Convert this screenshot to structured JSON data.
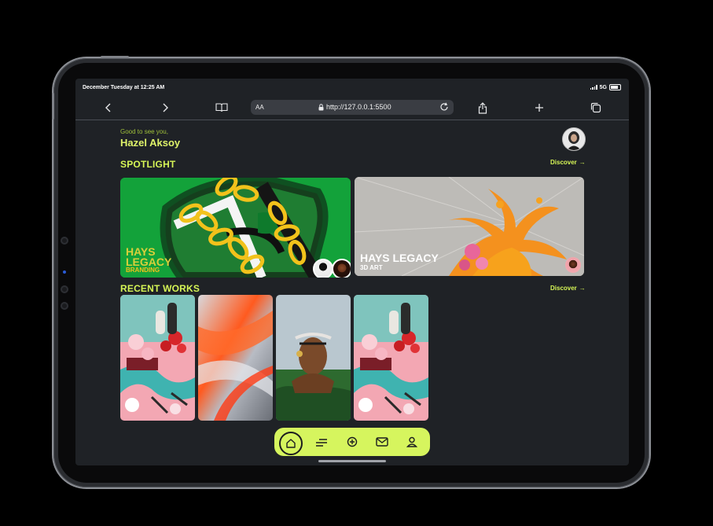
{
  "status_bar": {
    "time": "December Tuesday at 12:25 AM",
    "network": "5G"
  },
  "browser": {
    "aa_label": "AA",
    "url": "http://127.0.0.1:5500"
  },
  "header": {
    "greeting": "Good to see you,",
    "user_name": "Hazel Aksoy"
  },
  "spotlight": {
    "title": "SPOTLIGHT",
    "discover": "Discover",
    "cards": [
      {
        "title": "HAYS LEGACY",
        "subtitle": "BRANDING"
      },
      {
        "title": "HAYS LEGACY",
        "subtitle": "3D ART"
      }
    ]
  },
  "recent_works": {
    "title": "RECENT WORKS",
    "discover": "Discover"
  },
  "icons": {
    "back": "chevron-left-icon",
    "forward": "chevron-right-icon",
    "bookmarks": "book-icon",
    "lock": "lock-icon",
    "reload": "reload-icon",
    "share": "share-icon",
    "new_tab": "plus-icon",
    "tabs": "tabs-icon",
    "nav": [
      "home-icon",
      "menu-icon",
      "add-icon",
      "mail-icon",
      "user-icon"
    ]
  },
  "colors": {
    "accent": "#d6f55e",
    "background": "#1f2226"
  }
}
